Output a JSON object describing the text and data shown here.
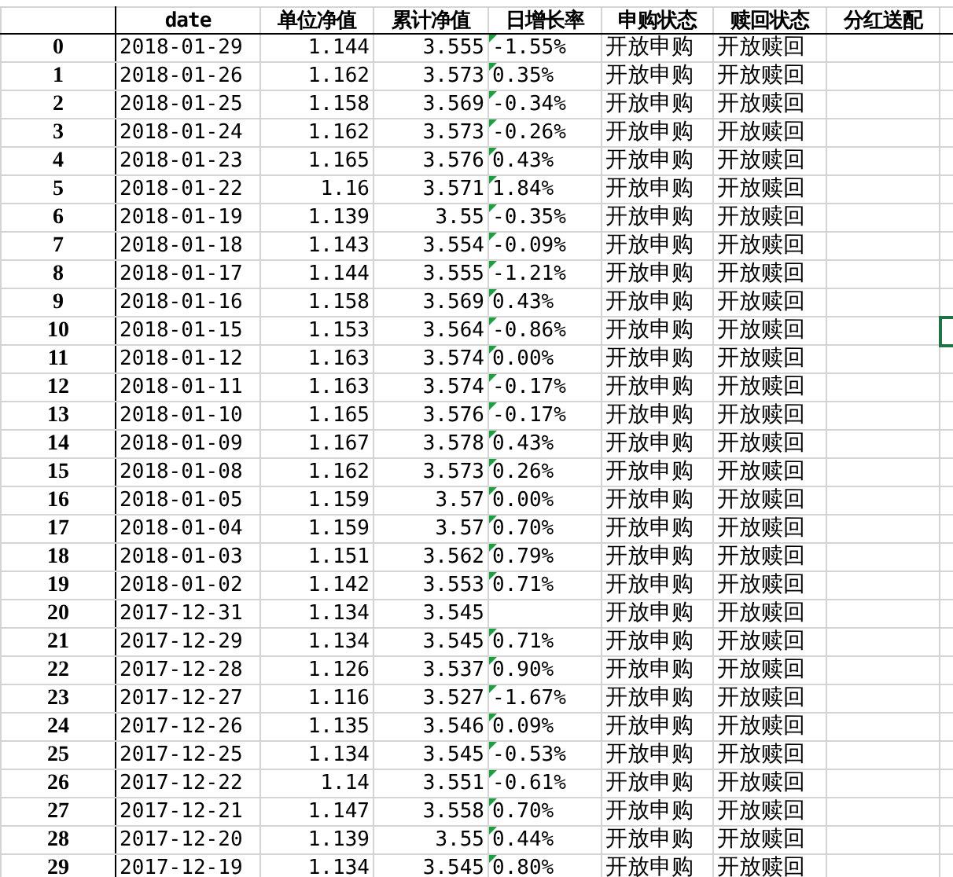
{
  "columns": [
    "date",
    "单位净值",
    "累计净值",
    "日增长率",
    "申购状态",
    "赎回状态",
    "分红送配"
  ],
  "rows": [
    {
      "index": "0",
      "date": "2018-01-29",
      "unit_nav": "1.144",
      "cum_nav": "3.555",
      "daily_change": "-1.55%",
      "flag": true,
      "subscribe": "开放申购",
      "redeem": "开放赎回",
      "selected": false
    },
    {
      "index": "1",
      "date": "2018-01-26",
      "unit_nav": "1.162",
      "cum_nav": "3.573",
      "daily_change": "0.35%",
      "flag": true,
      "subscribe": "开放申购",
      "redeem": "开放赎回",
      "selected": false
    },
    {
      "index": "2",
      "date": "2018-01-25",
      "unit_nav": "1.158",
      "cum_nav": "3.569",
      "daily_change": "-0.34%",
      "flag": true,
      "subscribe": "开放申购",
      "redeem": "开放赎回",
      "selected": false
    },
    {
      "index": "3",
      "date": "2018-01-24",
      "unit_nav": "1.162",
      "cum_nav": "3.573",
      "daily_change": "-0.26%",
      "flag": true,
      "subscribe": "开放申购",
      "redeem": "开放赎回",
      "selected": false
    },
    {
      "index": "4",
      "date": "2018-01-23",
      "unit_nav": "1.165",
      "cum_nav": "3.576",
      "daily_change": "0.43%",
      "flag": true,
      "subscribe": "开放申购",
      "redeem": "开放赎回",
      "selected": false
    },
    {
      "index": "5",
      "date": "2018-01-22",
      "unit_nav": "1.16",
      "cum_nav": "3.571",
      "daily_change": "1.84%",
      "flag": true,
      "subscribe": "开放申购",
      "redeem": "开放赎回",
      "selected": false
    },
    {
      "index": "6",
      "date": "2018-01-19",
      "unit_nav": "1.139",
      "cum_nav": "3.55",
      "daily_change": "-0.35%",
      "flag": true,
      "subscribe": "开放申购",
      "redeem": "开放赎回",
      "selected": false
    },
    {
      "index": "7",
      "date": "2018-01-18",
      "unit_nav": "1.143",
      "cum_nav": "3.554",
      "daily_change": "-0.09%",
      "flag": true,
      "subscribe": "开放申购",
      "redeem": "开放赎回",
      "selected": false
    },
    {
      "index": "8",
      "date": "2018-01-17",
      "unit_nav": "1.144",
      "cum_nav": "3.555",
      "daily_change": "-1.21%",
      "flag": true,
      "subscribe": "开放申购",
      "redeem": "开放赎回",
      "selected": false
    },
    {
      "index": "9",
      "date": "2018-01-16",
      "unit_nav": "1.158",
      "cum_nav": "3.569",
      "daily_change": "0.43%",
      "flag": true,
      "subscribe": "开放申购",
      "redeem": "开放赎回",
      "selected": false
    },
    {
      "index": "10",
      "date": "2018-01-15",
      "unit_nav": "1.153",
      "cum_nav": "3.564",
      "daily_change": "-0.86%",
      "flag": true,
      "subscribe": "开放申购",
      "redeem": "开放赎回",
      "selected": true
    },
    {
      "index": "11",
      "date": "2018-01-12",
      "unit_nav": "1.163",
      "cum_nav": "3.574",
      "daily_change": "0.00%",
      "flag": true,
      "subscribe": "开放申购",
      "redeem": "开放赎回",
      "selected": false
    },
    {
      "index": "12",
      "date": "2018-01-11",
      "unit_nav": "1.163",
      "cum_nav": "3.574",
      "daily_change": "-0.17%",
      "flag": true,
      "subscribe": "开放申购",
      "redeem": "开放赎回",
      "selected": false
    },
    {
      "index": "13",
      "date": "2018-01-10",
      "unit_nav": "1.165",
      "cum_nav": "3.576",
      "daily_change": "-0.17%",
      "flag": true,
      "subscribe": "开放申购",
      "redeem": "开放赎回",
      "selected": false
    },
    {
      "index": "14",
      "date": "2018-01-09",
      "unit_nav": "1.167",
      "cum_nav": "3.578",
      "daily_change": "0.43%",
      "flag": true,
      "subscribe": "开放申购",
      "redeem": "开放赎回",
      "selected": false
    },
    {
      "index": "15",
      "date": "2018-01-08",
      "unit_nav": "1.162",
      "cum_nav": "3.573",
      "daily_change": "0.26%",
      "flag": true,
      "subscribe": "开放申购",
      "redeem": "开放赎回",
      "selected": false
    },
    {
      "index": "16",
      "date": "2018-01-05",
      "unit_nav": "1.159",
      "cum_nav": "3.57",
      "daily_change": "0.00%",
      "flag": true,
      "subscribe": "开放申购",
      "redeem": "开放赎回",
      "selected": false
    },
    {
      "index": "17",
      "date": "2018-01-04",
      "unit_nav": "1.159",
      "cum_nav": "3.57",
      "daily_change": "0.70%",
      "flag": true,
      "subscribe": "开放申购",
      "redeem": "开放赎回",
      "selected": false
    },
    {
      "index": "18",
      "date": "2018-01-03",
      "unit_nav": "1.151",
      "cum_nav": "3.562",
      "daily_change": "0.79%",
      "flag": true,
      "subscribe": "开放申购",
      "redeem": "开放赎回",
      "selected": false
    },
    {
      "index": "19",
      "date": "2018-01-02",
      "unit_nav": "1.142",
      "cum_nav": "3.553",
      "daily_change": "0.71%",
      "flag": true,
      "subscribe": "开放申购",
      "redeem": "开放赎回",
      "selected": false
    },
    {
      "index": "20",
      "date": "2017-12-31",
      "unit_nav": "1.134",
      "cum_nav": "3.545",
      "flag": false,
      "subscribe": "开放申购",
      "redeem": "开放赎回",
      "selected": false
    },
    {
      "index": "21",
      "date": "2017-12-29",
      "unit_nav": "1.134",
      "cum_nav": "3.545",
      "daily_change": "0.71%",
      "flag": true,
      "subscribe": "开放申购",
      "redeem": "开放赎回",
      "selected": false
    },
    {
      "index": "22",
      "date": "2017-12-28",
      "unit_nav": "1.126",
      "cum_nav": "3.537",
      "daily_change": "0.90%",
      "flag": true,
      "subscribe": "开放申购",
      "redeem": "开放赎回",
      "selected": false
    },
    {
      "index": "23",
      "date": "2017-12-27",
      "unit_nav": "1.116",
      "cum_nav": "3.527",
      "daily_change": "-1.67%",
      "flag": true,
      "subscribe": "开放申购",
      "redeem": "开放赎回",
      "selected": false
    },
    {
      "index": "24",
      "date": "2017-12-26",
      "unit_nav": "1.135",
      "cum_nav": "3.546",
      "daily_change": "0.09%",
      "flag": true,
      "subscribe": "开放申购",
      "redeem": "开放赎回",
      "selected": false
    },
    {
      "index": "25",
      "date": "2017-12-25",
      "unit_nav": "1.134",
      "cum_nav": "3.545",
      "daily_change": "-0.53%",
      "flag": true,
      "subscribe": "开放申购",
      "redeem": "开放赎回",
      "selected": false
    },
    {
      "index": "26",
      "date": "2017-12-22",
      "unit_nav": "1.14",
      "cum_nav": "3.551",
      "daily_change": "-0.61%",
      "flag": true,
      "subscribe": "开放申购",
      "redeem": "开放赎回",
      "selected": false
    },
    {
      "index": "27",
      "date": "2017-12-21",
      "unit_nav": "1.147",
      "cum_nav": "3.558",
      "daily_change": "0.70%",
      "flag": true,
      "subscribe": "开放申购",
      "redeem": "开放赎回",
      "selected": false
    },
    {
      "index": "28",
      "date": "2017-12-20",
      "unit_nav": "1.139",
      "cum_nav": "3.55",
      "daily_change": "0.44%",
      "flag": true,
      "subscribe": "开放申购",
      "redeem": "开放赎回",
      "selected": false
    },
    {
      "index": "29",
      "date": "2017-12-19",
      "unit_nav": "1.134",
      "cum_nav": "3.545",
      "daily_change": "0.80%",
      "flag": true,
      "subscribe": "开放申购",
      "redeem": "开放赎回",
      "selected": false
    }
  ]
}
